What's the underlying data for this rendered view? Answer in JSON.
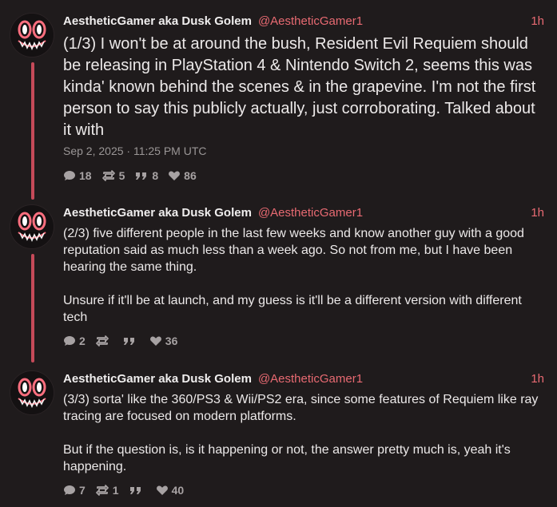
{
  "posts": [
    {
      "display_name": "AestheticGamer aka Dusk Golem",
      "handle": "@AestheticGamer1",
      "time_ago": "1h",
      "text": "(1/3) I won't be at around the bush, Resident Evil Requiem should be releasing in PlayStation 4 & Nintendo Switch 2, seems this was kinda' known behind the scenes & in the grapevine. I'm not the first person to say this publicly actually, just corroborating. Talked about it with",
      "timestamp": "Sep 2, 2025 · 11:25 PM UTC",
      "replies": "18",
      "reposts": "5",
      "quotes": "8",
      "likes": "86"
    },
    {
      "display_name": "AestheticGamer aka Dusk Golem",
      "handle": "@AestheticGamer1",
      "time_ago": "1h",
      "text": "(2/3) five different people in the last few weeks and know another guy with a good reputation said as much less than a week ago. So not from me, but I have been hearing the same thing.\n\nUnsure if it'll be at launch, and my guess is it'll be a different version with different tech",
      "replies": "2",
      "reposts": "",
      "quotes": "",
      "likes": "36"
    },
    {
      "display_name": "AestheticGamer aka Dusk Golem",
      "handle": "@AestheticGamer1",
      "time_ago": "1h",
      "text": "(3/3) sorta' like the 360/PS3 & Wii/PS2 era, since some features of Requiem like ray tracing are focused on modern platforms.\n\nBut if the question is, is it happening or not, the answer pretty much is, yeah it's happening.",
      "replies": "7",
      "reposts": "1",
      "quotes": "",
      "likes": "40"
    }
  ],
  "icons": {
    "reply": "speech-bubble-icon",
    "repost": "repost-arrows-icon",
    "quote": "quote-marks-icon",
    "like": "heart-icon"
  },
  "colors": {
    "background": "#1f1b1c",
    "accent": "#e86a72",
    "thread_line": "#c54a59",
    "muted": "#a7a2a3"
  }
}
